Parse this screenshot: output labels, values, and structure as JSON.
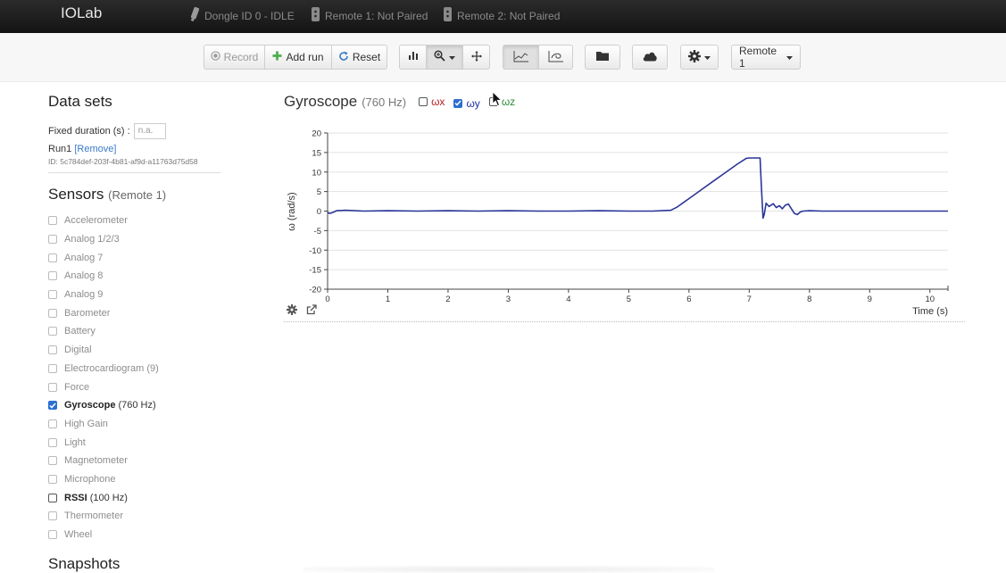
{
  "app": {
    "brand": "IOLab",
    "dongle_status": "Dongle ID 0 - IDLE",
    "remote1_status": "Remote 1: Not Paired",
    "remote2_status": "Remote 2: Not Paired"
  },
  "toolbar": {
    "record_label": "Record",
    "add_run_label": "Add run",
    "reset_label": "Reset",
    "remote_select_label": "Remote 1"
  },
  "sidebar": {
    "datasets_title": "Data sets",
    "fixed_duration_label": "Fixed duration (s) :",
    "fixed_duration_placeholder": "n.a.",
    "run_name": "Run1",
    "remove_label": "[Remove]",
    "run_id": "ID: 5c784def-203f-4b81-af9d-a11763d75d58",
    "sensors_title": "Sensors",
    "sensors_subtitle": "(Remote 1)",
    "sensors": [
      {
        "label": "Accelerometer",
        "checked": false
      },
      {
        "label": "Analog 1/2/3",
        "checked": false
      },
      {
        "label": "Analog 7",
        "checked": false
      },
      {
        "label": "Analog 8",
        "checked": false
      },
      {
        "label": "Analog 9",
        "checked": false
      },
      {
        "label": "Barometer",
        "checked": false
      },
      {
        "label": "Battery",
        "checked": false
      },
      {
        "label": "Digital",
        "checked": false
      },
      {
        "label": "Electrocardiogram (9)",
        "checked": false
      },
      {
        "label": "Force",
        "checked": false
      },
      {
        "label": "Gyroscope",
        "rate": "(760 Hz)",
        "checked": true
      },
      {
        "label": "High Gain",
        "checked": false
      },
      {
        "label": "Light",
        "checked": false
      },
      {
        "label": "Magnetometer",
        "checked": false
      },
      {
        "label": "Microphone",
        "checked": false
      },
      {
        "label": "RSSI",
        "rate": "(100 Hz)",
        "checked": false
      },
      {
        "label": "Thermometer",
        "checked": false
      },
      {
        "label": "Wheel",
        "checked": false
      }
    ],
    "snapshots_title": "Snapshots"
  },
  "chart_panel": {
    "title": "Gyroscope",
    "rate": "(760 Hz)",
    "toggles": [
      {
        "label": "ωx",
        "checked": false,
        "color": "#b22222"
      },
      {
        "label": "ωy",
        "checked": true,
        "color": "#1f2fa0"
      },
      {
        "label": "ωz",
        "checked": false,
        "color": "#2e8b3a"
      }
    ]
  },
  "colors": {
    "series_wy": "#2a3598",
    "checkbox_checked": "#2b6fd1",
    "navbar": "#1e1e1e",
    "link": "#3a7ac8"
  },
  "chart_data": {
    "type": "line",
    "xlabel": "Time (s)",
    "ylabel": "ω (rad/s)",
    "xlim": [
      0,
      10.3
    ],
    "ylim": [
      -20,
      20
    ],
    "xticks": [
      "0",
      "1",
      "2",
      "3",
      "4",
      "5",
      "6",
      "7",
      "8",
      "9",
      "10"
    ],
    "yticks": [
      "20",
      "15",
      "10",
      "5",
      "0",
      "-5",
      "-10",
      "-15",
      "-20"
    ],
    "grid": true,
    "series": [
      {
        "name": "ωy",
        "color": "#2a3598",
        "x": [
          0.0,
          0.03,
          0.08,
          0.15,
          0.3,
          0.6,
          1.0,
          1.5,
          2.0,
          2.5,
          3.0,
          3.5,
          4.0,
          4.5,
          5.0,
          5.4,
          5.7,
          5.8,
          6.0,
          6.2,
          6.4,
          6.6,
          6.8,
          6.95,
          7.0,
          7.05,
          7.1,
          7.18,
          7.2,
          7.23,
          7.25,
          7.28,
          7.33,
          7.4,
          7.45,
          7.5,
          7.55,
          7.6,
          7.65,
          7.7,
          7.75,
          7.8,
          7.85,
          7.9,
          8.0,
          8.2,
          9.0,
          10.3
        ],
        "values": [
          -0.3,
          -0.6,
          -0.4,
          0.1,
          0.2,
          0.0,
          0.1,
          0.0,
          0.1,
          0.0,
          0.1,
          0.0,
          0.0,
          0.1,
          0.0,
          0.0,
          0.2,
          1.0,
          3.2,
          5.4,
          7.6,
          9.8,
          12.0,
          13.5,
          13.6,
          13.6,
          13.6,
          13.6,
          7.0,
          -1.8,
          -0.8,
          2.0,
          1.2,
          1.9,
          0.9,
          1.4,
          0.6,
          1.5,
          1.8,
          0.6,
          -0.6,
          -0.9,
          -0.2,
          0.0,
          0.1,
          0.0,
          0.0,
          0.0
        ]
      }
    ]
  }
}
